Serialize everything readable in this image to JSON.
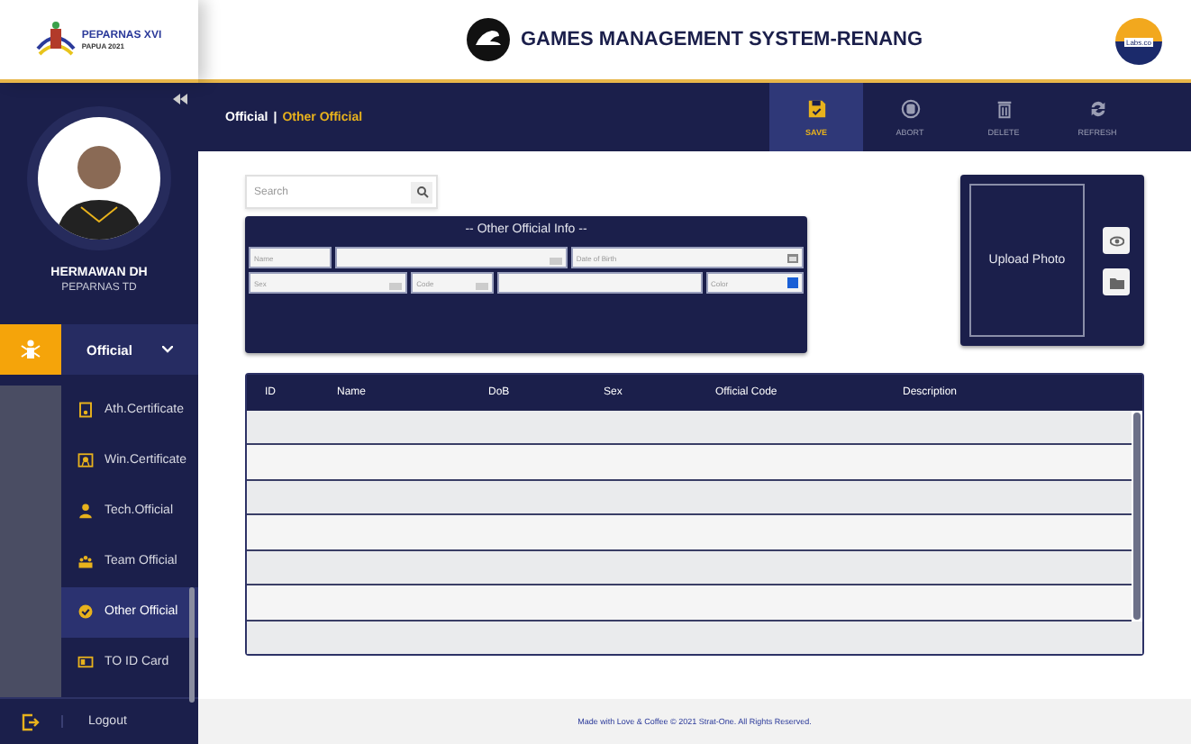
{
  "header": {
    "logo_title": "PEPARNAS XVI",
    "logo_subtitle": "PAPUA 2021",
    "title": "GAMES MANAGEMENT SYSTEM-RENANG",
    "partner_logo": "Labs.co"
  },
  "user": {
    "name": "HERMAWAN DH",
    "role": "PEPARNAS TD"
  },
  "menu": {
    "label": "Official",
    "expanded": true,
    "items": [
      {
        "label": "Ath.Certificate",
        "kind": "certificate",
        "selected": false
      },
      {
        "label": "Win.Certificate",
        "kind": "award",
        "selected": false
      },
      {
        "label": "Tech.Official",
        "kind": "person",
        "selected": false
      },
      {
        "label": "Team Official",
        "kind": "team",
        "selected": false
      },
      {
        "label": "Other Official",
        "kind": "check",
        "selected": true
      },
      {
        "label": "TO ID Card",
        "kind": "card",
        "selected": false
      }
    ]
  },
  "logout": "Logout",
  "breadcrumb": {
    "parent": "Official",
    "separator": "|",
    "current": "Other Official"
  },
  "toolbar": [
    {
      "label": "SAVE",
      "kind": "save",
      "selected": true
    },
    {
      "label": "ABORT",
      "kind": "abort",
      "selected": false
    },
    {
      "label": "DELETE",
      "kind": "delete",
      "selected": false
    },
    {
      "label": "REFRESH",
      "kind": "refresh",
      "selected": false
    }
  ],
  "search": {
    "placeholder": "Search"
  },
  "info_panel": {
    "title": "-- Other Official Info --",
    "rows": [
      [
        {
          "kind": "text",
          "placeholder": "Name"
        },
        {
          "kind": "dropdown"
        },
        {
          "kind": "date",
          "placeholder": "Date of Birth"
        }
      ],
      [
        {
          "kind": "dropdown",
          "placeholder": "Sex"
        },
        {
          "kind": "dropdown",
          "placeholder": "Code"
        },
        {
          "kind": "text"
        },
        {
          "kind": "color",
          "placeholder": "Color",
          "color": "#1a5fd6"
        }
      ]
    ]
  },
  "photo": {
    "label": "Upload Photo"
  },
  "table": {
    "columns": [
      "ID",
      "Name",
      "DoB",
      "Sex",
      "Official Code",
      "Description"
    ]
  },
  "footer": "Made with Love & Coffee © 2021 Strat-One. All Rights Reserved."
}
